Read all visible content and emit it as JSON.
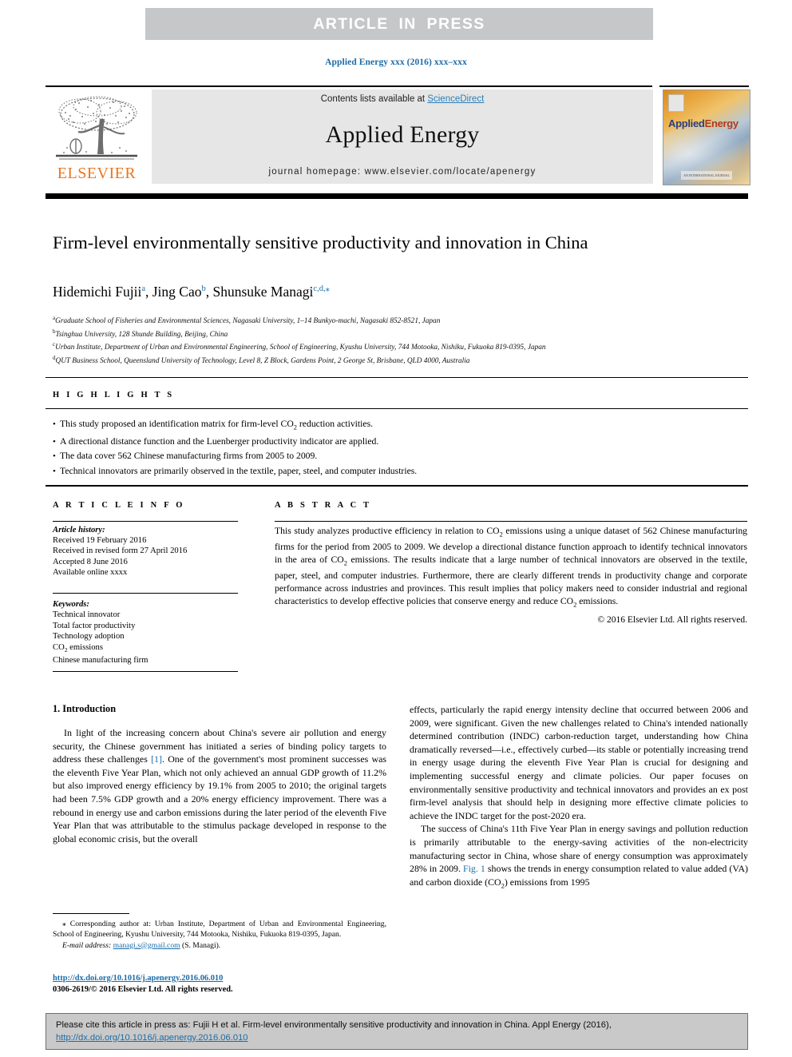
{
  "banner": {
    "text": "ARTICLE  IN  PRESS"
  },
  "running_head": "Applied Energy xxx (2016) xxx–xxx",
  "masthead": {
    "contents_prefix": "Contents lists available at ",
    "sciencedirect": "ScienceDirect",
    "journal_name": "Applied Energy",
    "homepage": "journal homepage: www.elsevier.com/locate/apenergy",
    "elsevier_wordmark": "ELSEVIER",
    "cover": {
      "title_applied": "Applied",
      "title_energy": "Energy",
      "footer_text": "AN INTERNATIONAL JOURNAL"
    }
  },
  "article": {
    "title": "Firm-level environmentally sensitive productivity and innovation in China",
    "authors": [
      {
        "name": "Hidemichi Fujii",
        "marks": "a",
        "sep": ", "
      },
      {
        "name": "Jing Cao",
        "marks": "b",
        "sep": ", "
      },
      {
        "name": "Shunsuke Managi",
        "marks": "c,d,⁎",
        "sep": ""
      }
    ],
    "affiliations": [
      {
        "mark": "a",
        "text": "Graduate School of Fisheries and Environmental Sciences, Nagasaki University, 1–14 Bunkyo-machi, Nagasaki 852-8521, Japan"
      },
      {
        "mark": "b",
        "text": "Tsinghua University, 128 Shunde Building, Beijing, China"
      },
      {
        "mark": "c",
        "text": "Urban Institute, Department of Urban and Environmental Engineering, School of Engineering, Kyushu University, 744 Motooka, Nishiku, Fukuoka 819-0395, Japan"
      },
      {
        "mark": "d",
        "text": "QUT Business School, Queensland University of Technology, Level 8, Z Block, Gardens Point, 2 George St, Brisbane, QLD 4000, Australia"
      }
    ]
  },
  "highlights": {
    "label": "H I G H L I G H T S",
    "items": [
      "This study proposed an identification matrix for firm-level CO₂ reduction activities.",
      "A directional distance function and the Luenberger productivity indicator are applied.",
      "The data cover 562 Chinese manufacturing firms from 2005 to 2009.",
      "Technical innovators are primarily observed in the textile, paper, steel, and computer industries."
    ]
  },
  "article_info": {
    "label": "A R T I C L E  I N F O",
    "history_heading": "Article history:",
    "history": [
      "Received 19 February 2016",
      "Received in revised form 27 April 2016",
      "Accepted 8 June 2016",
      "Available online xxxx"
    ],
    "keywords_heading": "Keywords:",
    "keywords": [
      "Technical innovator",
      "Total factor productivity",
      "Technology adoption",
      "CO₂ emissions",
      "Chinese manufacturing firm"
    ]
  },
  "abstract": {
    "label": "A B S T R A C T",
    "text": "This study analyzes productive efficiency in relation to CO₂ emissions using a unique dataset of 562 Chinese manufacturing firms for the period from 2005 to 2009. We develop a directional distance function approach to identify technical innovators in the area of CO₂ emissions. The results indicate that a large number of technical innovators are observed in the textile, paper, steel, and computer industries. Furthermore, there are clearly different trends in productivity change and corporate performance across industries and provinces. This result implies that policy makers need to consider industrial and regional characteristics to develop effective policies that conserve energy and reduce CO₂ emissions.",
    "copyright": "© 2016 Elsevier Ltd. All rights reserved."
  },
  "body": {
    "section_heading": "1. Introduction",
    "left_paragraph": "In light of the increasing concern about China's severe air pollution and energy security, the Chinese government has initiated a series of binding policy targets to address these challenges [1]. One of the government's most prominent successes was the eleventh Five Year Plan, which not only achieved an annual GDP growth of 11.2% but also improved energy efficiency by 19.1% from 2005 to 2010; the original targets had been 7.5% GDP growth and a 20% energy efficiency improvement. There was a rebound in energy use and carbon emissions during the later period of the eleventh Five Year Plan that was attributable to the stimulus package developed in response to the global economic crisis, but the overall",
    "left_citation": "[1]",
    "right_paragraph_1": "effects, particularly the rapid energy intensity decline that occurred between 2006 and 2009, were significant. Given the new challenges related to China's intended nationally determined contribution (INDC) carbon-reduction target, understanding how China dramatically reversed—i.e., effectively curbed—its stable or potentially increasing trend in energy usage during the eleventh Five Year Plan is crucial for designing and implementing successful energy and climate policies. Our paper focuses on environmentally sensitive productivity and technical innovators and provides an ex post firm-level analysis that should help in designing more effective climate policies to achieve the INDC target for the post-2020 era.",
    "right_paragraph_2": "The success of China's 11th Five Year Plan in energy savings and pollution reduction is primarily attributable to the energy-saving activities of the non-electricity manufacturing sector in China, whose share of energy consumption was approximately 28% in 2009. Fig. 1 shows the trends in energy consumption related to value added (VA) and carbon dioxide (CO₂) emissions from 1995",
    "right_figref": "Fig. 1"
  },
  "footnote": {
    "marker": "⁎",
    "corresponding": "Corresponding author at: Urban Institute, Department of Urban and Environmental Engineering, School of Engineering, Kyushu University, 744 Motooka, Nishiku, Fukuoka 819-0395, Japan.",
    "email_label": "E-mail address:",
    "email": "managi.s@gmail.com",
    "email_suffix": "(S. Managi)."
  },
  "doi": {
    "url": "http://dx.doi.org/10.1016/j.apenergy.2016.06.010",
    "issn_line": "0306-2619/© 2016 Elsevier Ltd. All rights reserved."
  },
  "citation_footer": {
    "text_before": "Please cite this article in press as: Fujii H et al. Firm-level environmentally sensitive productivity and innovation in China. Appl Energy (2016), ",
    "link": "http://dx.doi.org/10.1016/j.apenergy.2016.06.010"
  },
  "colors": {
    "banner_bg": "#c6c7c9",
    "link_blue": "#1b6ca8",
    "sciencedirect_blue": "#2a7fb8",
    "elsevier_orange": "#e87722",
    "masthead_gray": "#e6e6e6",
    "footer_gray": "#c9c9c9"
  }
}
